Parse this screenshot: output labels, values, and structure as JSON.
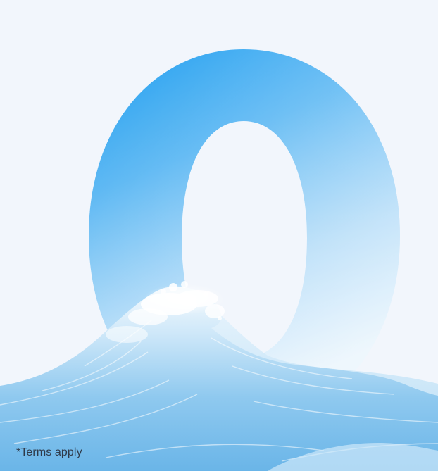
{
  "hero": {
    "digit": "0",
    "digit_gradient_top": "#1e9ff0",
    "digit_gradient_bottom": "#d7ecfb",
    "wave_color_main": "#8cc9f0",
    "wave_color_light": "#e6f4fd",
    "foam_color": "#ffffff",
    "background": "#f2f6fc"
  },
  "footer": {
    "terms_text": "*Terms apply"
  }
}
